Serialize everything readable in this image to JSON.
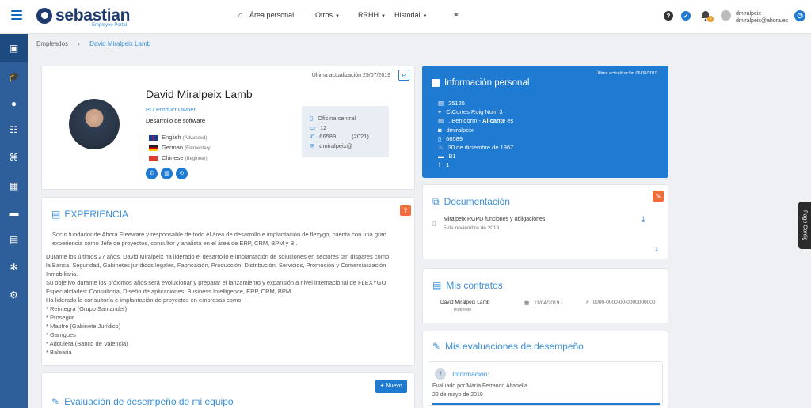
{
  "header": {
    "brand": "sebastian",
    "tagline": "Employee Portal",
    "nav": [
      {
        "label": "Área personal"
      },
      {
        "label": "Otros"
      },
      {
        "label": "RRHH"
      },
      {
        "label": "Historial"
      }
    ],
    "notif_count": "3",
    "user": {
      "name": "dmiralpeix",
      "email": "dmiralpeix@ahora.es"
    }
  },
  "breadcrumb": {
    "parent": "Empleados",
    "current": "David Miralpeix Lamb"
  },
  "profile": {
    "updated": "Última actualización 29/07/2019",
    "name": "David Miralpeix Lamb",
    "role": "PO Product Owner",
    "department": "Desarrollo de software",
    "languages": [
      {
        "name": "English",
        "level": "(Advanced)"
      },
      {
        "name": "German",
        "level": "(Elementary)"
      },
      {
        "name": "Chinese",
        "level": "(Beginner)"
      }
    ],
    "office": "Oficina central",
    "desk": "12",
    "phone": "66589",
    "phone_ext": "(2021)",
    "email": "dmiralpeix@"
  },
  "personal": {
    "title": "Información personal",
    "updated": "Última actualización 06/08/2019",
    "id": "25125",
    "address": "C\\Cortes Roig Num 3",
    "city_prefix": ", Benidorm - ",
    "province": "Alicante",
    "country": "es",
    "login": "dmiralpeix",
    "phone": "66589",
    "birth": "30 de diciembre de 1967",
    "license": "B1",
    "children": "1"
  },
  "experience": {
    "title": "EXPERIENCIA",
    "p1": "Socio fundador de Ahora Freeware y responsable de todo el área de desarrollo e implantación de flexygo, cuenta con una gran experiencia como Jefe de proyectos, consultor y analista en el área de ERP, CRM, BPM y BI.",
    "lines": [
      "Durante los últimos 27 años, David Miralpeix ha liderado el desarrollo e implantación de soluciones en sectores tan dispares como",
      "la Banca, Seguridad, Gabinetes jurídicos legales, Fabricación, Producción, Distribución, Servicios, Promoción y Comercialización",
      "Inmobiliaria.",
      "Su objetivo durante los próximos años será evolucionar y preparar el lanzamiento y expansión a nivel internacional de FLEXYGO",
      "Especialidades: Consultoría, Diseño de aplicaciones, Business Intelligence, ERP, CRM, BPM.",
      "Ha liderado la consultoría e implantación de proyectos en empresas como:",
      "* Reintegra (Grupo Santander)",
      "* Prosegur",
      "* Mapfre (Gabinete Jurídico)",
      "* Garrigues",
      "* Adquiera (Banco de Valencia)",
      "* Balearia"
    ]
  },
  "docs": {
    "title": "Documentación",
    "item_title": "Miralpeix RGPD funciones y obligaciones",
    "item_date": "5 de noviembre de 2019",
    "count": "1"
  },
  "contracts": {
    "title": "Mis contratos",
    "name": "David Miralpeix Lamb",
    "type": "Indefinite",
    "date": "11/04/2019 -",
    "number": "0000-0000-00-0000000000"
  },
  "evals": {
    "title": "Mis evaluaciones de desempeño",
    "info_title": "Información:",
    "by": "Evaluado por María Ferrando Altabella",
    "date": "22 de mayo de 2019"
  },
  "team": {
    "title": "Evaluación de desempeño de mi equipo",
    "new_label": "Nuevo"
  },
  "page_config": "Page Config"
}
